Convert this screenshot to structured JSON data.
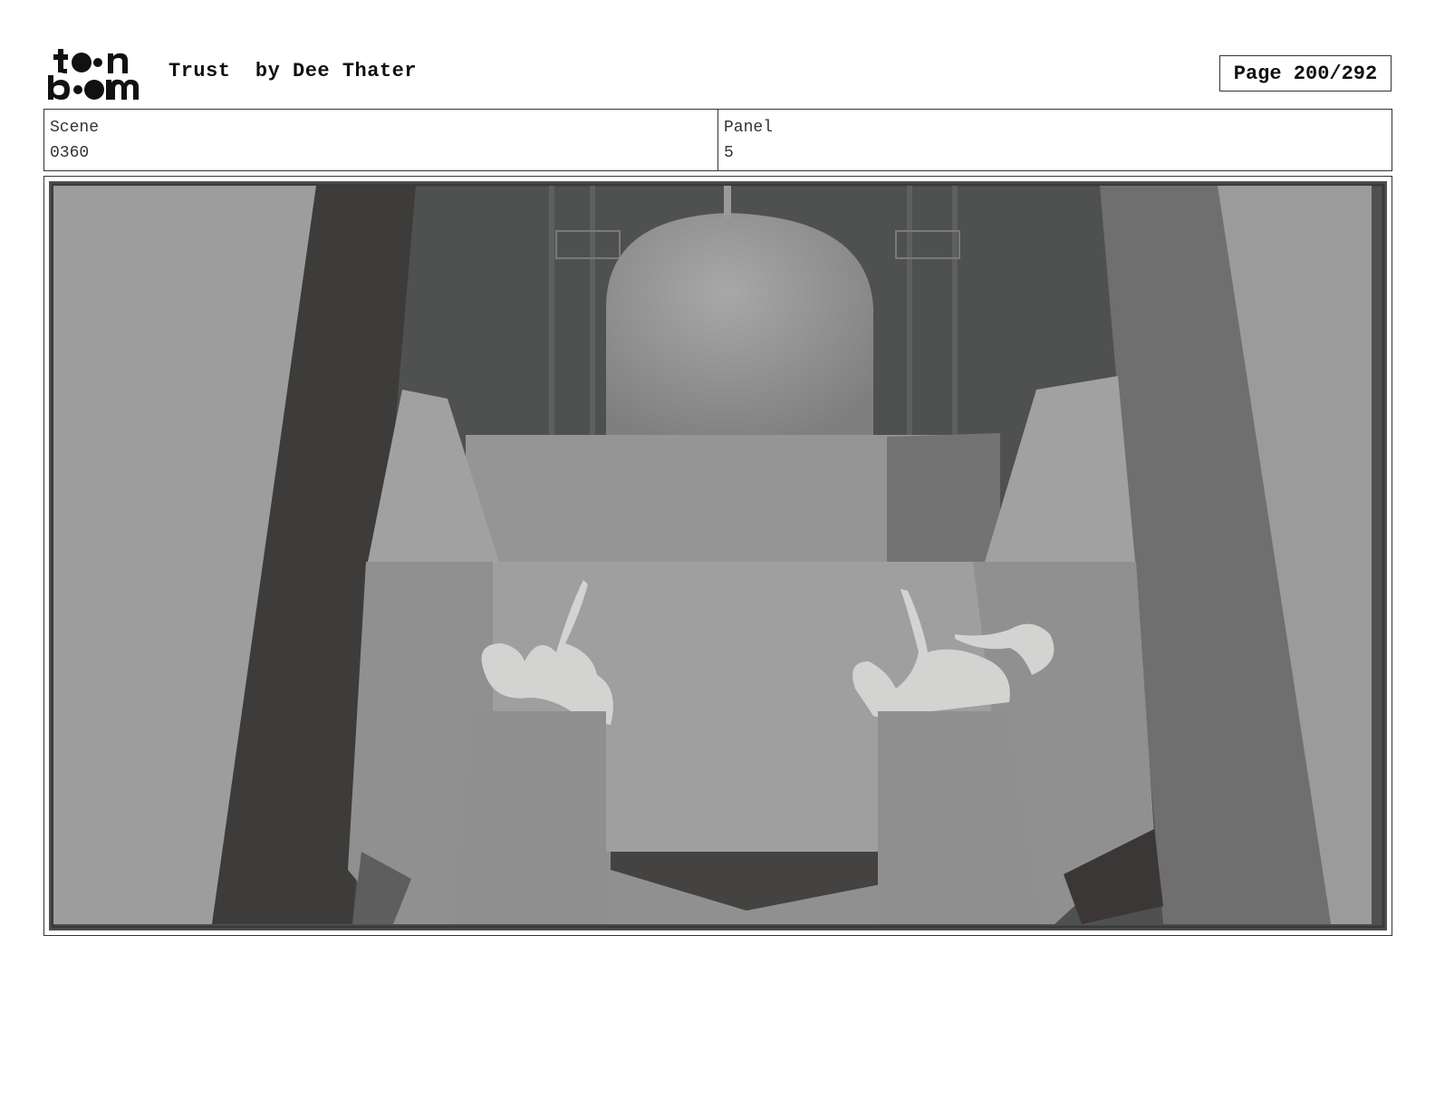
{
  "header": {
    "logo_text": "toon boom",
    "title": "Trust  by Dee Thater",
    "page_label": "Page 200/292"
  },
  "info": {
    "scene_label": "Scene",
    "scene_value": "0360",
    "panel_label": "Panel",
    "panel_value": "5"
  },
  "panel_image": {
    "description_icon": "storyboard-panel-image"
  }
}
